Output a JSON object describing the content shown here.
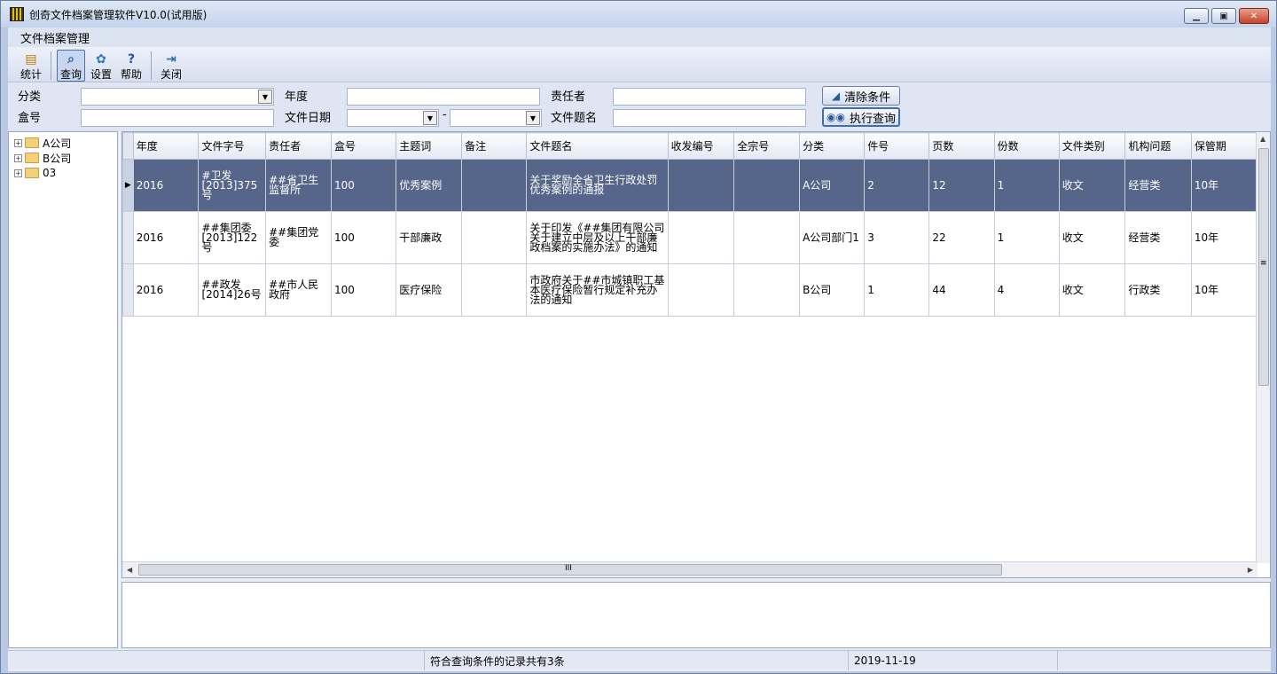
{
  "window": {
    "title": "创奇文件档案管理软件V10.0(试用版)"
  },
  "menu": {
    "items": [
      "文件档案管理"
    ]
  },
  "toolbar": {
    "stats": "统计",
    "query": "查询",
    "settings": "设置",
    "help": "帮助",
    "close": "关闭"
  },
  "search": {
    "category_label": "分类",
    "year_label": "年度",
    "responsible_label": "责任者",
    "box_label": "盒号",
    "date_label": "文件日期",
    "date_sep": "-",
    "title_label": "文件题名",
    "clear_button": "清除条件",
    "run_button": "执行查询"
  },
  "tree": {
    "items": [
      "A公司",
      "B公司",
      "03"
    ]
  },
  "grid": {
    "columns": [
      "年度",
      "文件字号",
      "责任者",
      "盒号",
      "主题词",
      "备注",
      "文件题名",
      "收发编号",
      "全宗号",
      "分类",
      "件号",
      "页数",
      "份数",
      "文件类别",
      "机构问题",
      "保管期"
    ],
    "rows": [
      [
        "2016",
        "#卫发[2013]375号",
        "##省卫生监督所",
        "100",
        "优秀案例",
        "",
        "关于奖励全省卫生行政处罚优秀案例的通报",
        "",
        "",
        "A公司",
        "2",
        "12",
        "1",
        "收文",
        "经营类",
        "10年"
      ],
      [
        "2016",
        "##集团委[2013]122号",
        "##集团党委",
        "100",
        "干部廉政",
        "",
        "关于印发《##集团有限公司关于建立中层及以上干部廉政档案的实施办法》的通知",
        "",
        "",
        "A公司部门1",
        "3",
        "22",
        "1",
        "收文",
        "经营类",
        "10年"
      ],
      [
        "2016",
        "##政发[2014]26号",
        "##市人民政府",
        "100",
        "医疗保险",
        "",
        "市政府关于##市城镇职工基本医疗保险暂行规定补充办法的通知",
        "",
        "",
        "B公司",
        "1",
        "44",
        "4",
        "收文",
        "行政类",
        "10年"
      ]
    ],
    "hscroll_grip": "III",
    "vscroll_grip": "≡"
  },
  "status": {
    "message": "符合查询条件的记录共有3条",
    "date": "2019-11-19"
  }
}
